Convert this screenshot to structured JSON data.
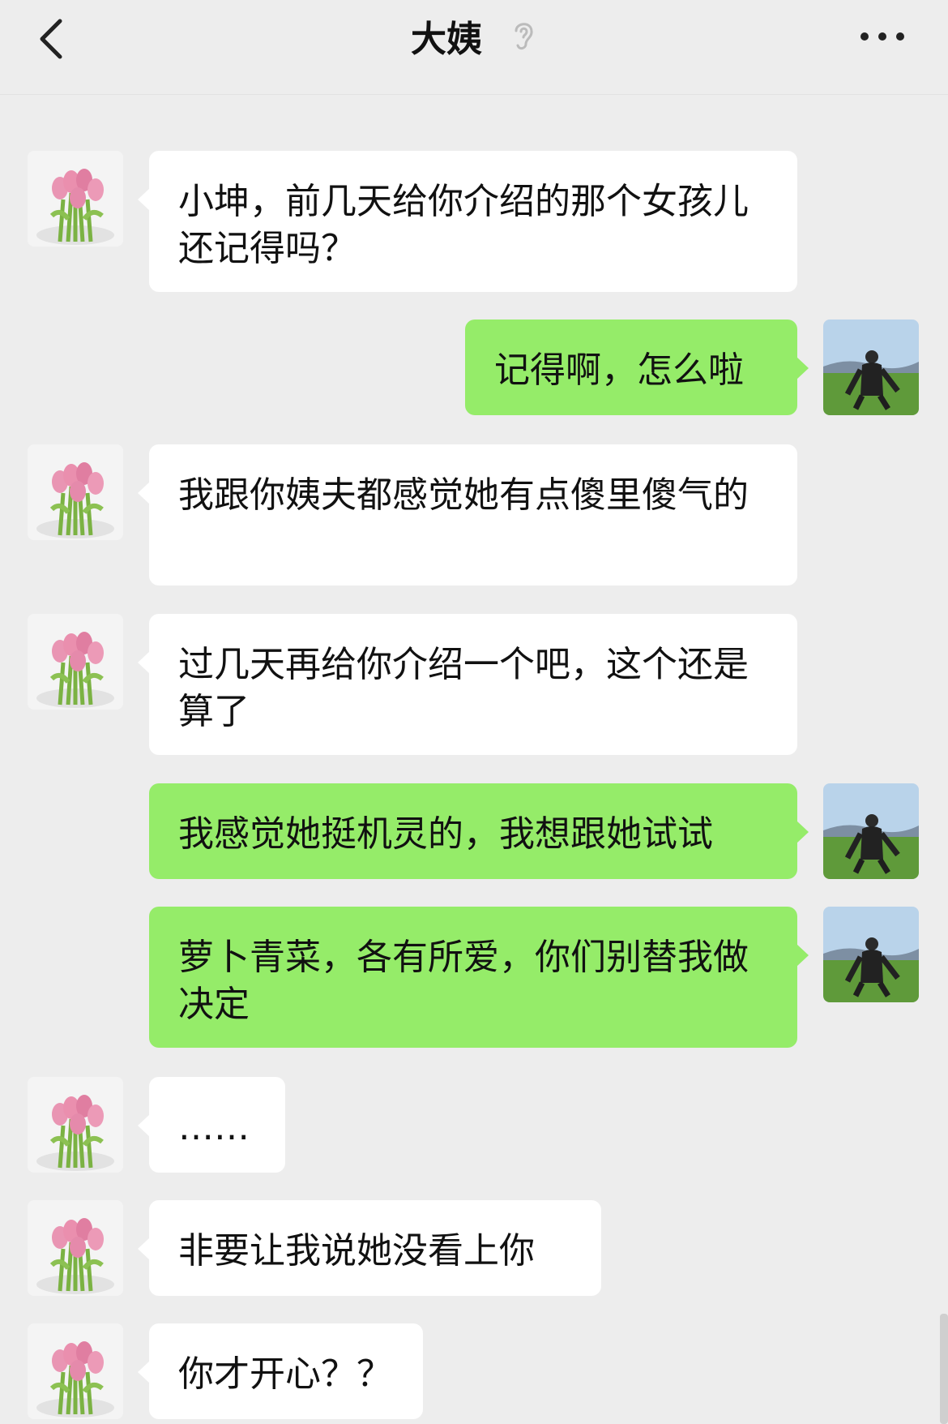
{
  "header": {
    "title": "大姨",
    "back_icon": "chevron-left-icon",
    "status_icon": "ear-icon",
    "more_icon": "more-dots-icon"
  },
  "colors": {
    "background": "#ededed",
    "incoming_bubble": "#ffffff",
    "outgoing_bubble": "#95ec69",
    "text": "#111111"
  },
  "messages": [
    {
      "from": "aunt",
      "avatar": "tulip-avatar",
      "text": "小坤，前几天给你介绍的那个女孩儿还记得吗？"
    },
    {
      "from": "me",
      "avatar": "landscape-avatar",
      "text": "记得啊，怎么啦"
    },
    {
      "from": "aunt",
      "avatar": "tulip-avatar",
      "text": "我跟你姨夫都感觉她有点傻里傻气的"
    },
    {
      "from": "aunt",
      "avatar": "tulip-avatar",
      "text": "过几天再给你介绍一个吧，这个还是算了"
    },
    {
      "from": "me",
      "avatar": "landscape-avatar",
      "text": "我感觉她挺机灵的，我想跟她试试"
    },
    {
      "from": "me",
      "avatar": "landscape-avatar",
      "text": "萝卜青菜，各有所爱，你们别替我做决定"
    },
    {
      "from": "aunt",
      "avatar": "tulip-avatar",
      "text": "……"
    },
    {
      "from": "aunt",
      "avatar": "tulip-avatar",
      "text": "非要让我说她没看上你"
    },
    {
      "from": "aunt",
      "avatar": "tulip-avatar",
      "text": "你才开心？？"
    }
  ]
}
